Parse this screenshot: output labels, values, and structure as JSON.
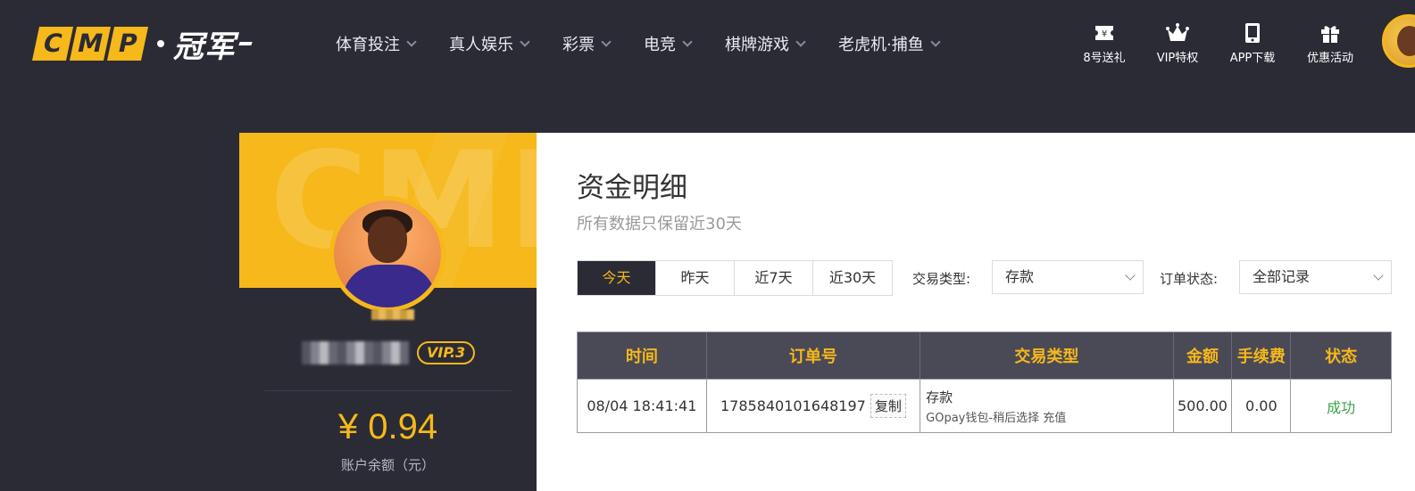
{
  "header": {
    "logo_letters": [
      "C",
      "M",
      "P"
    ],
    "logo_cn": "冠军",
    "nav": [
      {
        "label": "体育投注"
      },
      {
        "label": "真人娱乐"
      },
      {
        "label": "彩票"
      },
      {
        "label": "电竞"
      },
      {
        "label": "棋牌游戏"
      },
      {
        "label": "老虎机·捕鱼"
      }
    ],
    "quick": [
      {
        "label": "8号送礼",
        "icon": "ticket-icon"
      },
      {
        "label": "VIP特权",
        "icon": "crown-icon"
      },
      {
        "label": "APP下载",
        "icon": "phone-icon"
      },
      {
        "label": "优惠活动",
        "icon": "gift-icon"
      }
    ]
  },
  "profile": {
    "banner_watermark": "CMP",
    "vip": "VIP.3",
    "balance": "¥ 0.94",
    "balance_label": "账户余额（元）"
  },
  "main": {
    "title": "资金明细",
    "subtitle": "所有数据只保留近30天",
    "tabs": [
      {
        "label": "今天",
        "active": true
      },
      {
        "label": "昨天",
        "active": false
      },
      {
        "label": "近7天",
        "active": false
      },
      {
        "label": "近30天",
        "active": false
      }
    ],
    "type_filter": {
      "label": "交易类型:",
      "value": "存款"
    },
    "status_filter": {
      "label": "订单状态:",
      "value": "全部记录"
    },
    "table": {
      "headers": [
        "时间",
        "订单号",
        "交易类型",
        "金额",
        "手续费",
        "状态"
      ],
      "rows": [
        {
          "time": "08/04 18:41:41",
          "order_no": "1785840101648197",
          "copy": "复制",
          "type_main": "存款",
          "type_sub": "GOpay钱包-稍后选择 充值",
          "amount": "500.00",
          "fee": "0.00",
          "status": "成功"
        }
      ]
    }
  },
  "colors": {
    "accent": "#f6b81a",
    "dark_bg": "#2b2b36",
    "table_header": "#4a4a57",
    "success": "#3aa34a"
  }
}
